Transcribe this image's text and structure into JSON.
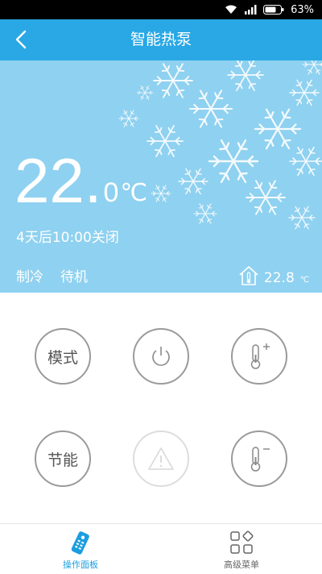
{
  "status_bar": {
    "battery_percent": "63%"
  },
  "header": {
    "title": "智能热泵"
  },
  "hero": {
    "temp_main": "22.",
    "temp_decimal": "0",
    "temp_unit": "℃",
    "timer_text": "4天后10:00关闭",
    "mode": "制冷",
    "state": "待机",
    "indoor_temp": "22.8",
    "indoor_unit": "℃"
  },
  "controls": {
    "mode_label": "模式",
    "eco_label": "节能"
  },
  "bottom_nav": {
    "tabs": [
      {
        "label": "操作面板",
        "active": true
      },
      {
        "label": "高级菜单",
        "active": false
      }
    ]
  },
  "colors": {
    "accent": "#29a8e5",
    "hero_bg": "#8fd1f0",
    "active_tab": "#1a9ee1"
  }
}
